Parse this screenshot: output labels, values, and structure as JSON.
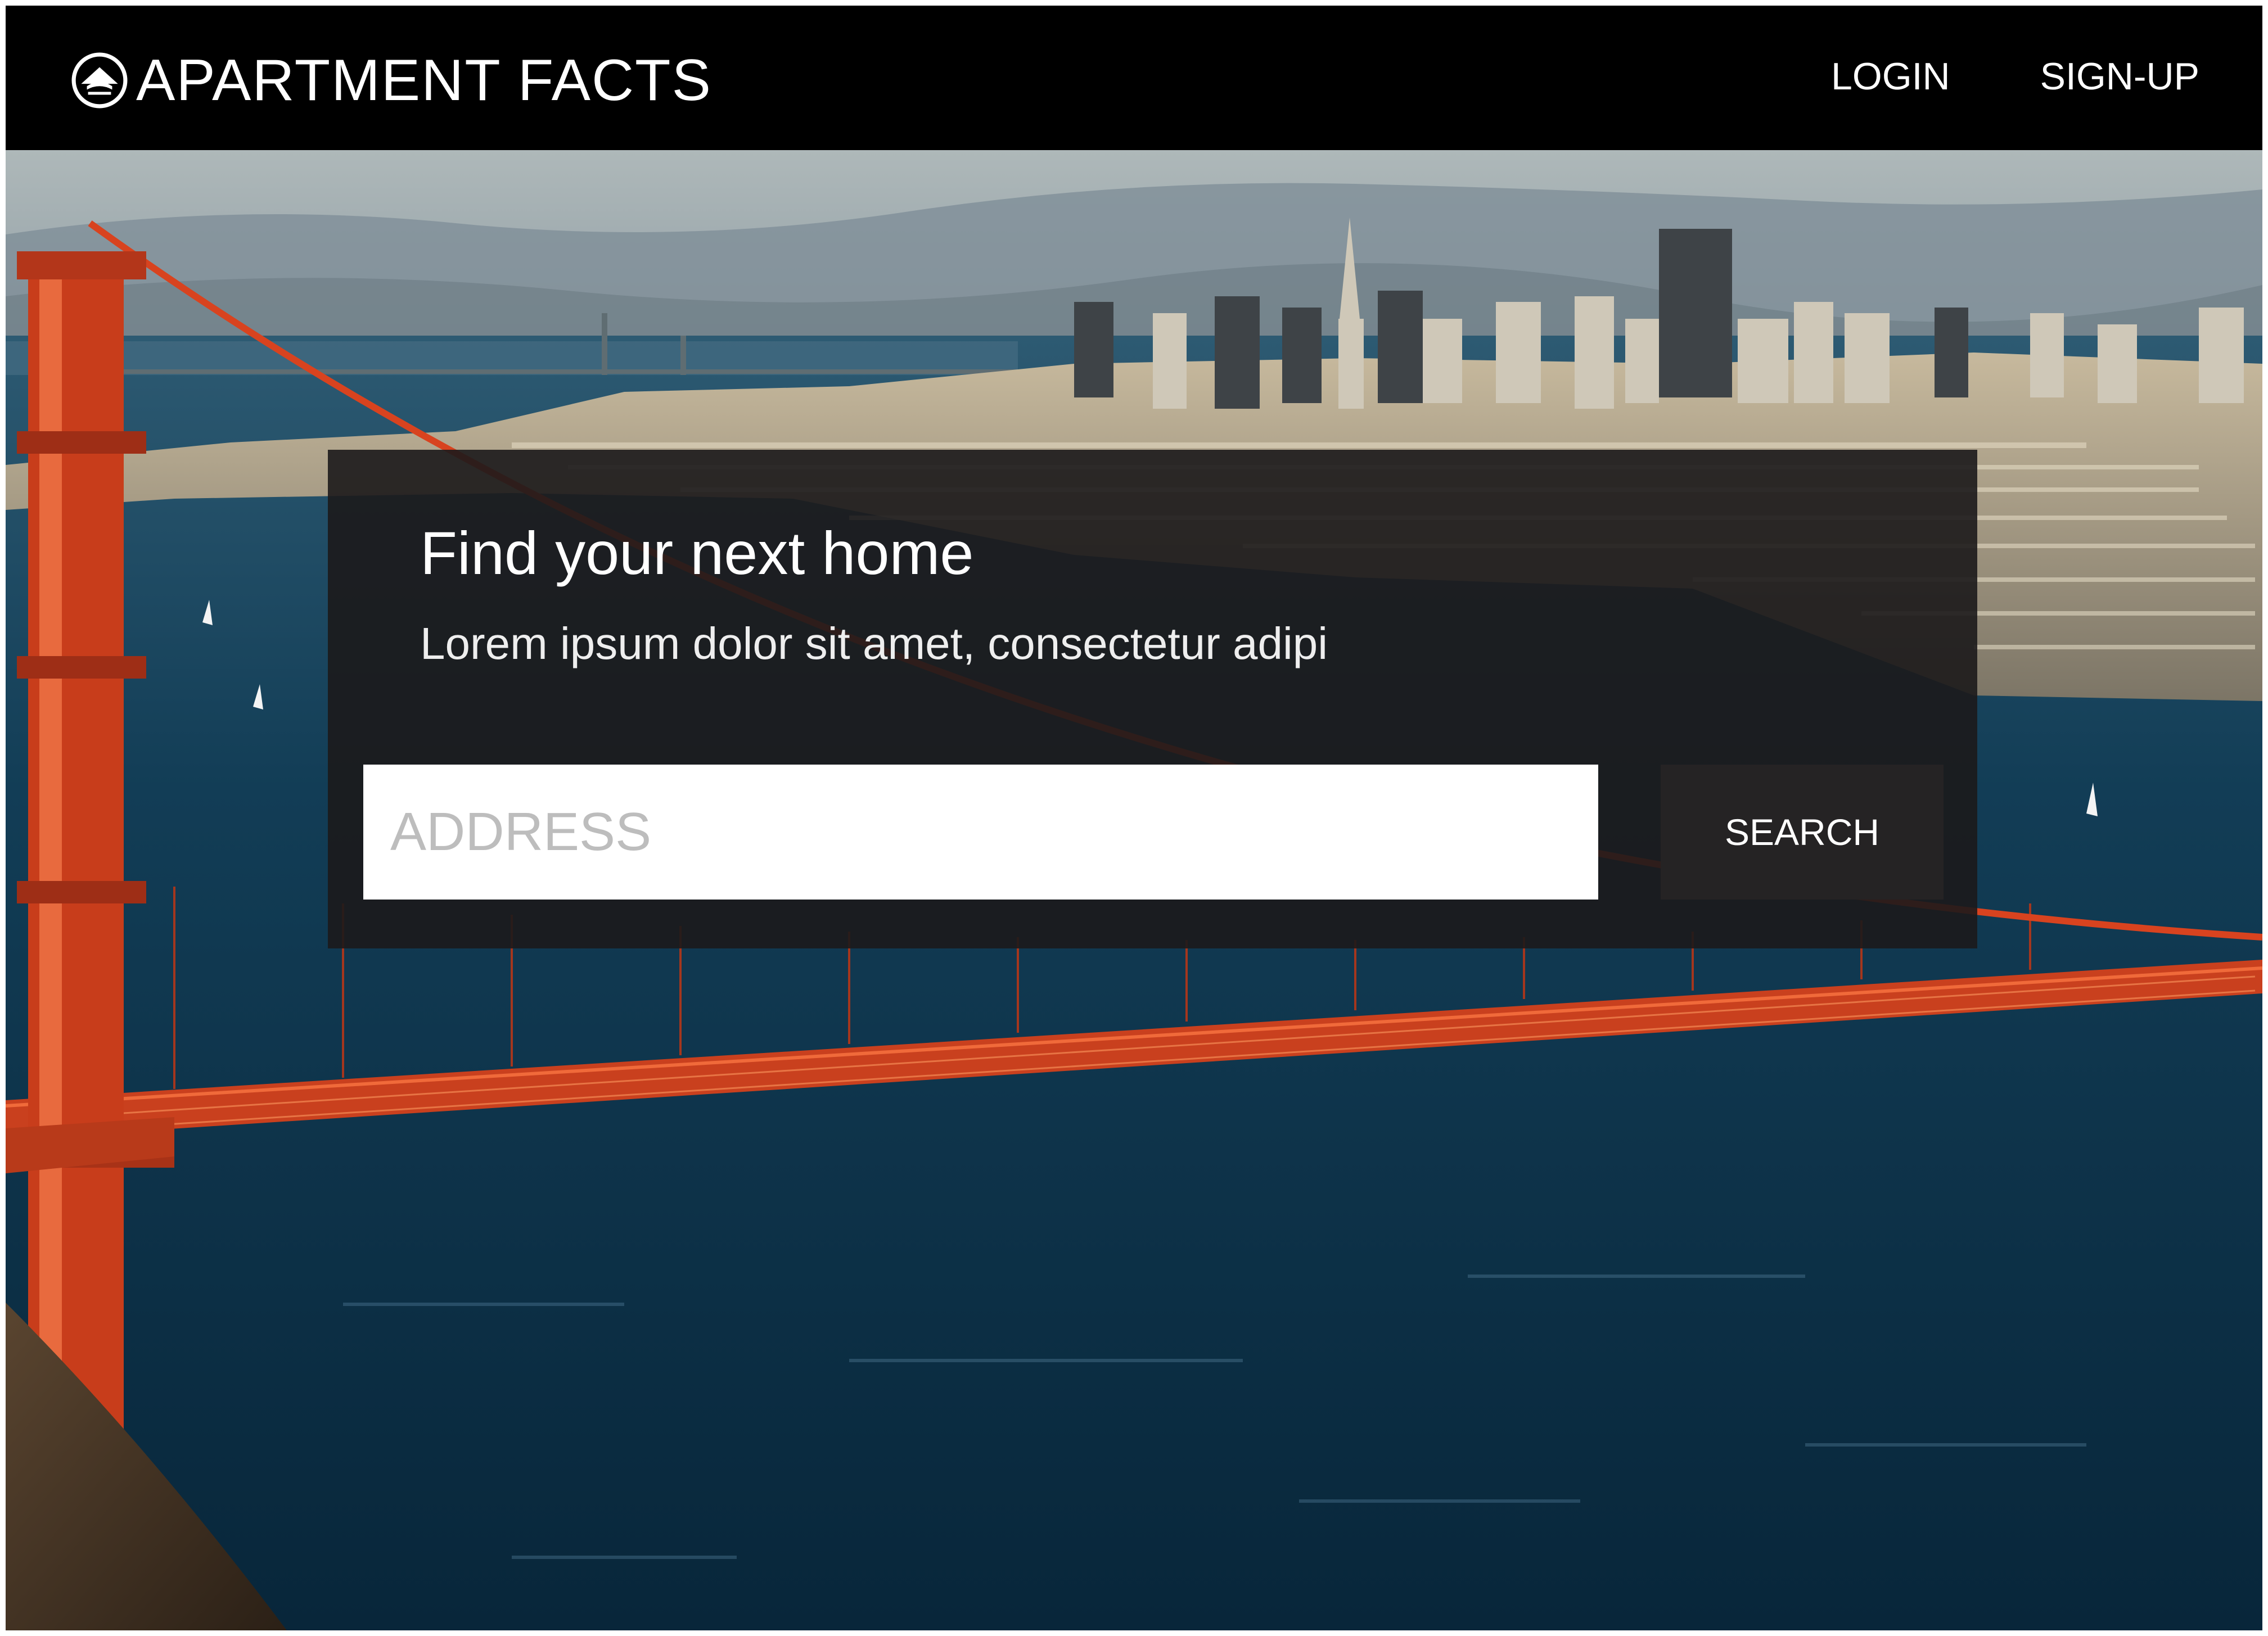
{
  "header": {
    "brand": "APARTMENT FACTS",
    "nav": {
      "login": "LOGIN",
      "signup": "SIGN-UP"
    }
  },
  "hero": {
    "image": "golden-gate-bridge-san-francisco-skyline-photo"
  },
  "search_panel": {
    "title": "Find your next home",
    "subtitle": "Lorem ipsum dolor sit amet, consectetur adipi",
    "address_placeholder": "ADDRESS",
    "address_value": "",
    "search_label": "SEARCH"
  },
  "colors": {
    "header_bg": "#000000",
    "panel_bg": "#1c1a1b",
    "bridge": "#d8431f",
    "water": "#0e2e45"
  },
  "icons": {
    "logo": "house-circle-icon"
  }
}
